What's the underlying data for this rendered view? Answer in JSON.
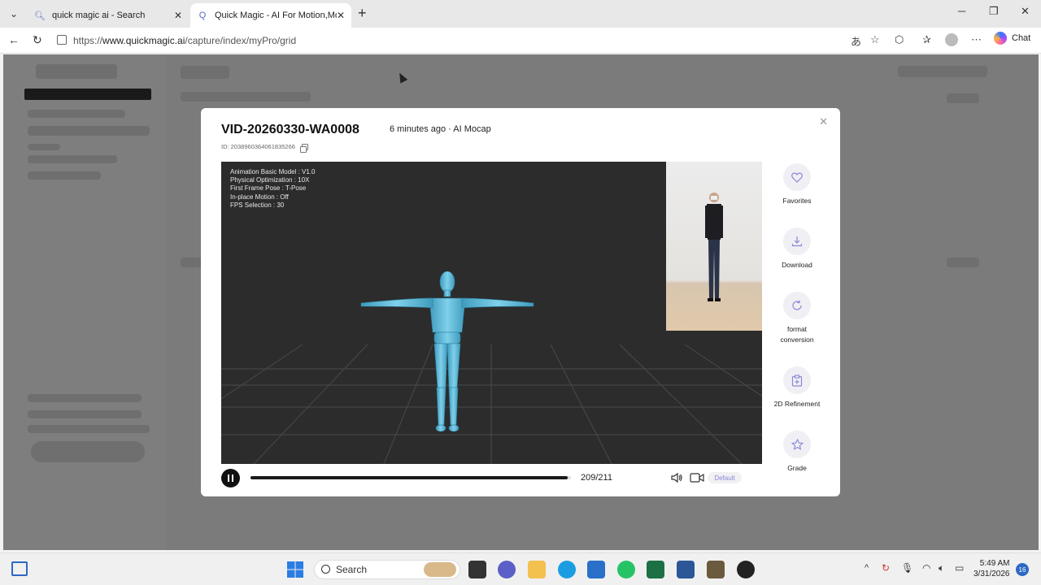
{
  "browser": {
    "tabs": [
      {
        "title": "quick magic ai - Search"
      },
      {
        "title": "Quick Magic - AI For Motion,Moti"
      }
    ],
    "url_prefix": "https://",
    "url_host": "www.quickmagic.ai",
    "url_path": "/capture/index/myPro/grid",
    "chat_label": "Chat"
  },
  "modal": {
    "title": "VID-20260330-WA0008",
    "meta": "6 minutes ago · AI Mocap",
    "id_text": "ID: 2038960364061835266",
    "info_lines": [
      "Animation Basic Model : V1.0",
      "Physical Optimization : 10X",
      "First Frame Pose : T-Pose",
      "In-place Motion : Off",
      "FPS Selection : 30"
    ],
    "player": {
      "current_frame": 209,
      "total_frames": 211,
      "frame_label": "209/211",
      "camera_mode": "Default"
    },
    "actions": [
      {
        "label": "Favorites",
        "icon": "heart-icon"
      },
      {
        "label": "Download",
        "icon": "download-icon"
      },
      {
        "label": "format conversion",
        "icon": "refresh-icon"
      },
      {
        "label": "2D Refinement",
        "icon": "clipboard-plus-icon"
      },
      {
        "label": "Grade",
        "icon": "star-icon"
      }
    ]
  },
  "taskbar": {
    "search_label": "Search",
    "time": "5:49 AM",
    "date": "3/31/2026",
    "notification_count": "16"
  },
  "colors": {
    "accent": "#8c87d6",
    "viewer_bg": "#2c2c2c",
    "model": "#5fb6d4"
  }
}
